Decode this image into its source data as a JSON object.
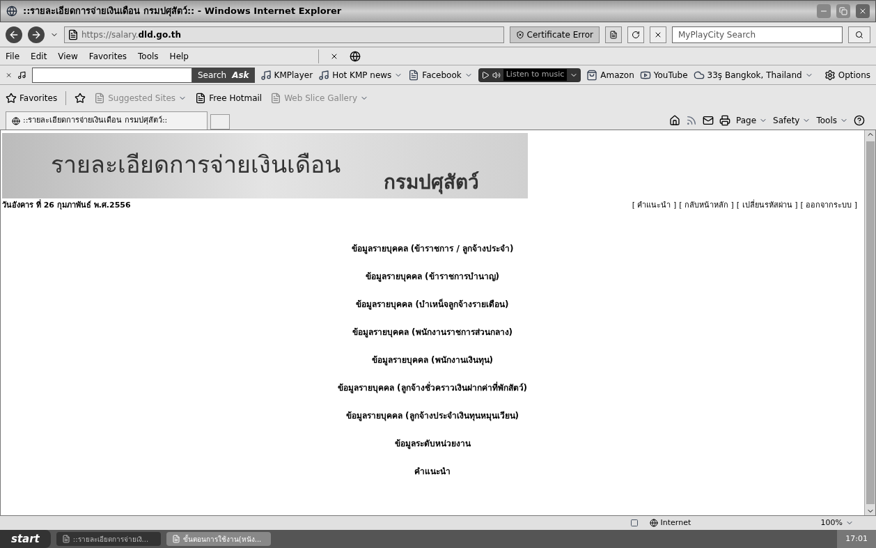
{
  "window": {
    "title": "::รายละเอียดการจ่ายเงินเดือน กรมปศุสัตว์:: - Windows Internet Explorer"
  },
  "address_bar": {
    "url_prefix": "https://salary.",
    "url_domain": "dld.go.th",
    "certificate": "Certificate Error",
    "search_placeholder": "MyPlayCity Search"
  },
  "menu": [
    "File",
    "Edit",
    "View",
    "Favorites",
    "Tools",
    "Help"
  ],
  "toolbar": {
    "search_button": "Search",
    "search_logo": "Ask",
    "items": [
      {
        "kind": "link",
        "label": "KMPlayer"
      },
      {
        "kind": "dropdown",
        "label": "Hot KMP news"
      },
      {
        "kind": "dropdown",
        "label": "Facebook"
      },
      {
        "kind": "player",
        "label": "Listen to music"
      },
      {
        "kind": "link",
        "label": "Amazon"
      },
      {
        "kind": "link",
        "label": "YouTube"
      },
      {
        "kind": "dropdown",
        "label": "33ş Bangkok, Thailand"
      }
    ],
    "options": "Options"
  },
  "favorites_bar": {
    "favorites": "Favorites",
    "items": [
      {
        "label": "Suggested Sites",
        "dropdown": true,
        "disabled": true
      },
      {
        "label": "Free Hotmail",
        "dropdown": false,
        "disabled": false
      },
      {
        "label": "Web Slice Gallery",
        "dropdown": true,
        "disabled": true
      }
    ]
  },
  "tabs": [
    {
      "label": "::รายละเอียดการจ่ายเงินเดือน กรมปศุสัตว์::",
      "selected": true
    }
  ],
  "command_bar": [
    "Page",
    "Safety",
    "Tools"
  ],
  "page": {
    "banner_title": "รายละเอียดการจ่ายเงินเดือน",
    "banner_org": "กรมปศุสัตว์",
    "date": "วันอังคาร ที่ 26 กุมภาพันธ์ พ.ศ.2556",
    "nav_links": [
      "[ คำแนะนำ ]",
      "[ กลับหน้าหลัก ]",
      "[ เปลี่ยนรหัสผ่าน ]",
      "[ ออกจากระบบ ]"
    ],
    "menu_links": [
      "ข้อมูลรายบุคคล (ข้าราชการ / ลูกจ้างประจำ)",
      "ข้อมูลรายบุคคล (ข้าราชการบำนาญ)",
      "ข้อมูลรายบุคคล (บำเหน็จลูกจ้างรายเดือน)",
      "ข้อมูลรายบุคคล (พนักงานราชการส่วนกลาง)",
      "ข้อมูลรายบุคคล (พนักงานเงินทุน)",
      "ข้อมูลรายบุคคล (ลูกจ้างชั่วคราวเงินฝากค่าที่พักสัตว์)",
      "ข้อมูลรายบุคคล (ลูกจ้างประจำเงินทุนหมุนเวียน)",
      "ข้อมูลระดับหน่วยงาน",
      "คำแนะนำ"
    ]
  },
  "status_bar": {
    "zone": "Internet",
    "zoom": "100%"
  },
  "taskbar": {
    "start": "start",
    "tasks": [
      {
        "label": "::รายละเอียดการจ่ายเงิ...",
        "selected": true
      },
      {
        "label": "ขั้นตอนการใช้งาน(หนัง...",
        "selected": false
      }
    ],
    "clock": "17:01"
  }
}
